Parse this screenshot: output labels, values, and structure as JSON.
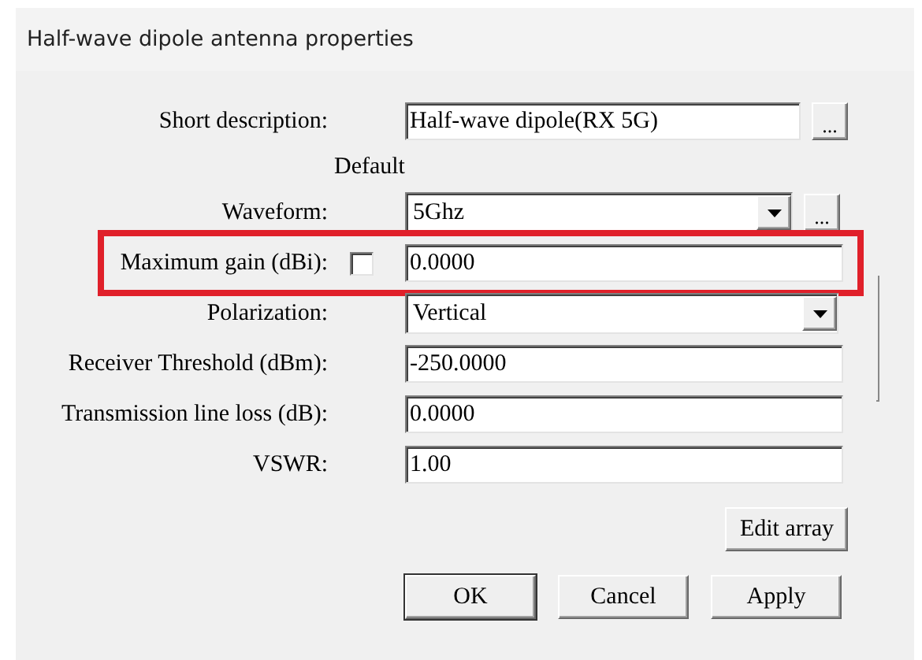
{
  "window": {
    "title": "Half-wave dipole antenna properties"
  },
  "fields": [
    {
      "kind": "text",
      "label": "Short description:",
      "value": "Half-wave dipole(RX 5G)",
      "browse": "...",
      "highlighted": false
    },
    {
      "kind": "heading",
      "label": "Default"
    },
    {
      "kind": "combo",
      "label": "Waveform:",
      "value": "5Ghz",
      "browse": "...",
      "highlighted": false
    },
    {
      "kind": "check_text",
      "label": "Maximum gain (dBi):",
      "checked": false,
      "value": "0.0000",
      "highlighted": true
    },
    {
      "kind": "combo",
      "label": "Polarization:",
      "value": "Vertical",
      "highlighted": false
    },
    {
      "kind": "text",
      "label": "Receiver Threshold (dBm):",
      "value": "-250.0000",
      "highlighted": false
    },
    {
      "kind": "text",
      "label": "Transmission line loss (dB):",
      "value": "0.0000",
      "highlighted": false
    },
    {
      "kind": "text",
      "label": "VSWR:",
      "value": "1.00",
      "highlighted": false
    }
  ],
  "edit_button": "Edit array",
  "buttons": [
    {
      "label": "OK",
      "default": true
    },
    {
      "label": "Cancel",
      "default": false
    },
    {
      "label": "Apply",
      "default": false
    }
  ]
}
